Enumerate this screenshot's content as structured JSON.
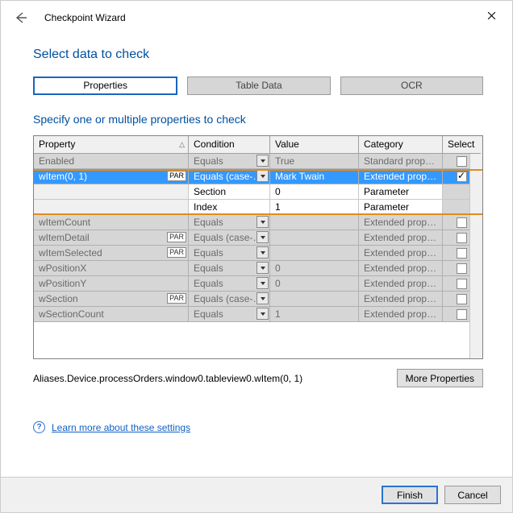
{
  "window": {
    "title": "Checkpoint Wizard"
  },
  "page": {
    "heading": "Select data to check",
    "subheading": "Specify one or multiple properties to check"
  },
  "tabs": {
    "properties": "Properties",
    "table_data": "Table Data",
    "ocr": "OCR"
  },
  "columns": {
    "property": "Property",
    "condition": "Condition",
    "value": "Value",
    "category": "Category",
    "select": "Select"
  },
  "badges": {
    "par": "PAR"
  },
  "rows": {
    "enabled": {
      "property": "Enabled",
      "condition": "Equals",
      "value": "True",
      "category": "Standard property"
    },
    "witem": {
      "property": "wItem(0, 1)",
      "condition": "Equals (case-…",
      "value": "Mark Twain",
      "category": "Extended property"
    },
    "witem_section": {
      "property": "",
      "condition": "Section",
      "value": "0",
      "category": "Parameter"
    },
    "witem_index": {
      "property": "",
      "condition": "Index",
      "value": "1",
      "category": "Parameter"
    },
    "witemcount": {
      "property": "wItemCount",
      "condition": "Equals",
      "value": "",
      "category": "Extended property"
    },
    "witemdetail": {
      "property": "wItemDetail",
      "condition": "Equals (case-…",
      "value": "",
      "category": "Extended property"
    },
    "witemselected": {
      "property": "wItemSelected",
      "condition": "Equals",
      "value": "",
      "category": "Extended property"
    },
    "wpositionx": {
      "property": "wPositionX",
      "condition": "Equals",
      "value": "0",
      "category": "Extended property"
    },
    "wpositiony": {
      "property": "wPositionY",
      "condition": "Equals",
      "value": "0",
      "category": "Extended property"
    },
    "wsection": {
      "property": "wSection",
      "condition": "Equals (case-…",
      "value": "",
      "category": "Extended property"
    },
    "wsectioncount": {
      "property": "wSectionCount",
      "condition": "Equals",
      "value": "1",
      "category": "Extended property"
    }
  },
  "path": "Aliases.Device.processOrders.window0.tableview0.wItem(0, 1)",
  "buttons": {
    "more_properties": "More Properties",
    "finish": "Finish",
    "cancel": "Cancel"
  },
  "link": "Learn more about these settings"
}
